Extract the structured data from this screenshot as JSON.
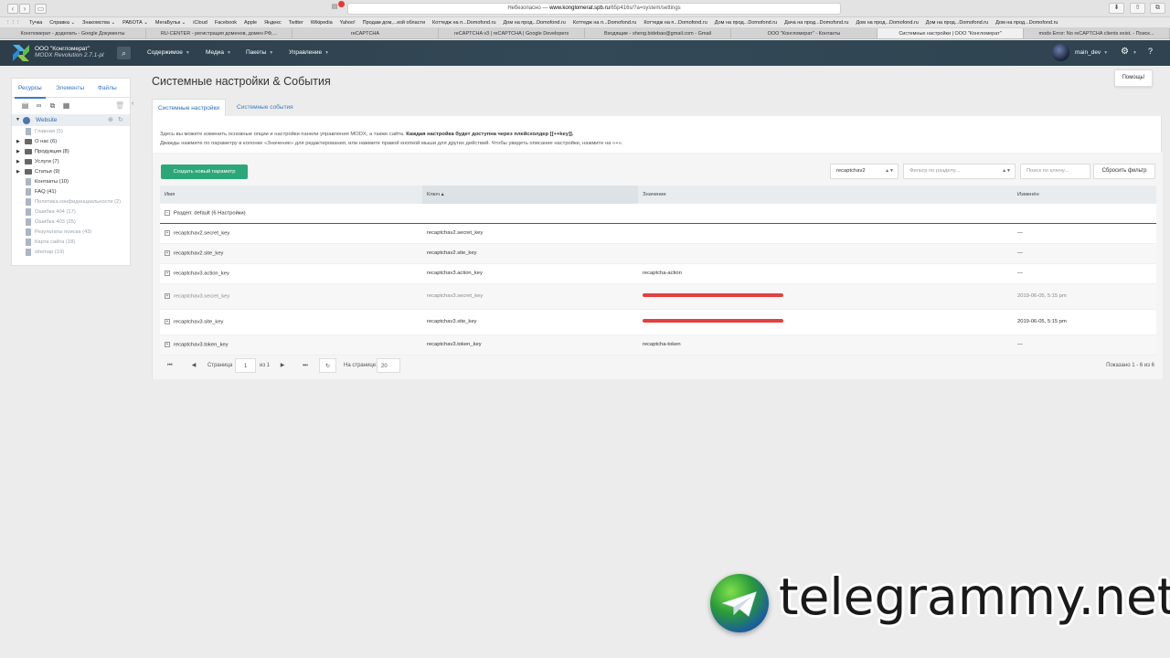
{
  "browser": {
    "url_prefix": "Небезопасно — ",
    "url_host": "www.konglomerat.spb.ru",
    "url_path": "/65p416s/?a=system/settings",
    "bookmarks": [
      "Тучка",
      "Справка ⌄",
      "Знакомства ⌄",
      "РАБОТА ⌄",
      "МегаБульк ⌄",
      "iCloud",
      "Facebook",
      "Apple",
      "Яндекс",
      "Twitter",
      "Wikipedia",
      "Yahoo!",
      "Продам дом,...кой области",
      "Коттедж на п...Domofond.ru",
      "Дом на прод...Domofond.ru",
      "Коттедж на п...Domofond.ru",
      "Коттедж на п...Domofond.ru",
      "Дом на прод...Domofond.ru",
      "Дача на прод...Domofond.ru",
      "Дом на прод...Domofond.ru",
      "Дом на прод...Domofond.ru",
      "Дом на прод...Domofond.ru"
    ],
    "tabs": [
      {
        "label": "Конгломерат - доделать - Google Документы",
        "active": false
      },
      {
        "label": "RU-CENTER - регистрация доменов, домен РФ,...",
        "active": false
      },
      {
        "label": "reCAPTCHA",
        "active": false
      },
      {
        "label": "reCAPTCHA v3 | reCAPTCHA | Google Developers",
        "active": false
      },
      {
        "label": "Входящие - sheng.bidebao@gmail.com - Gmail",
        "active": false
      },
      {
        "label": "ООО \"Конгломерат\" - Контакты",
        "active": false
      },
      {
        "label": "Системные настройки | ООО \"Конгломерат\"",
        "active": true
      },
      {
        "label": "modx Error: No reCAPTCHA clients exist. - Поиск...",
        "active": false
      }
    ]
  },
  "topnav": {
    "brand_name": "ООО \"Конгломерат\"",
    "brand_version": "MODX Revolution 2.7.1-pl",
    "menu": [
      "Содержимое",
      "Медиа",
      "Пакеты",
      "Управление"
    ],
    "user": "main_dev"
  },
  "sidebar": {
    "tabs": [
      "Ресурсы",
      "Элементы",
      "Файлы"
    ],
    "root": "Website",
    "items": [
      {
        "label": "Главная (5)",
        "type": "doc",
        "dim": true,
        "arrow": ""
      },
      {
        "label": "О нас (6)",
        "type": "folder",
        "dim": false,
        "arrow": "▶"
      },
      {
        "label": "Продукция (8)",
        "type": "folder",
        "dim": false,
        "arrow": "▶"
      },
      {
        "label": "Услуги (7)",
        "type": "folder",
        "dim": false,
        "arrow": "▶"
      },
      {
        "label": "Статьи (9)",
        "type": "folder",
        "dim": false,
        "arrow": "▶"
      },
      {
        "label": "Контакты (10)",
        "type": "doc",
        "dim": false,
        "arrow": ""
      },
      {
        "label": "FAQ (41)",
        "type": "doc",
        "dim": false,
        "arrow": ""
      },
      {
        "label": "Политика конфиденциальности (2)",
        "type": "doc",
        "dim": true,
        "arrow": ""
      },
      {
        "label": "Ошибка 404 (17)",
        "type": "doc",
        "dim": true,
        "arrow": ""
      },
      {
        "label": "Ошибка 403 (25)",
        "type": "doc",
        "dim": true,
        "arrow": ""
      },
      {
        "label": "Результаты поиска (43)",
        "type": "doc",
        "dim": true,
        "arrow": ""
      },
      {
        "label": "Карта сайта (18)",
        "type": "doc",
        "dim": true,
        "arrow": ""
      },
      {
        "label": "sitemap (19)",
        "type": "doc",
        "dim": true,
        "arrow": ""
      }
    ]
  },
  "page": {
    "title": "Системные настройки & События",
    "help": "Помощь!",
    "tabs": [
      "Системные настройки",
      "Системные события"
    ],
    "desc_line1_plain": "Здесь вы можете изменить основные опции и настройки панели управления MODX, а также сайта. ",
    "desc_line1_bold": "Каждая настройка будет доступна через плейсхолдер [[++key]].",
    "desc_line2": "Дважды нажмите по параметру в колонке «Значение» для редактирования, или нажмите правой кнопкой мыши для других действий. Чтобы увидеть описание настройки, нажмите на «+»."
  },
  "grid": {
    "create_label": "Создать новый параметр",
    "namespace_value": "recaptchav2",
    "area_placeholder": "Фильтр по разделу...",
    "key_placeholder": "Поиск по ключу...",
    "reset_label": "Сбросить фильтр",
    "columns": [
      "Имя",
      "Ключ ▴",
      "Значение",
      "Изменён"
    ],
    "group_label": "Раздел: default (6 Настройки)",
    "rows": [
      {
        "name": "recaptchav2.secret_key",
        "key": "recaptchav2.secret_key",
        "value": "",
        "redacted": false,
        "modified": "—"
      },
      {
        "name": "recaptchav2.site_key",
        "key": "recaptchav2.site_key",
        "value": "",
        "redacted": false,
        "modified": "—"
      },
      {
        "name": "recaptchav3.action_key",
        "key": "recaptchav3.action_key",
        "value": "recaptcha-action",
        "redacted": false,
        "modified": "—"
      },
      {
        "name": "recaptchav3.secret_key",
        "key": "recaptchav3.secret_key",
        "value": "",
        "redacted": true,
        "modified": "2019-06-05, 5:15 pm"
      },
      {
        "name": "recaptchav3.site_key",
        "key": "recaptchav3.site_key",
        "value": "",
        "redacted": true,
        "modified": "2019-06-05, 5:15 pm"
      },
      {
        "name": "recaptchav3.token_key",
        "key": "recaptchav3.token_key",
        "value": "recaptcha-token",
        "redacted": false,
        "modified": "—"
      }
    ],
    "pager": {
      "page_label": "Страница",
      "page_value": "1",
      "of_label": "из 1",
      "per_page_label": "На странице:",
      "per_page_value": "20",
      "summary": "Показано 1 - 6 из 6"
    }
  },
  "watermark": {
    "text": "telegrammy.net"
  }
}
